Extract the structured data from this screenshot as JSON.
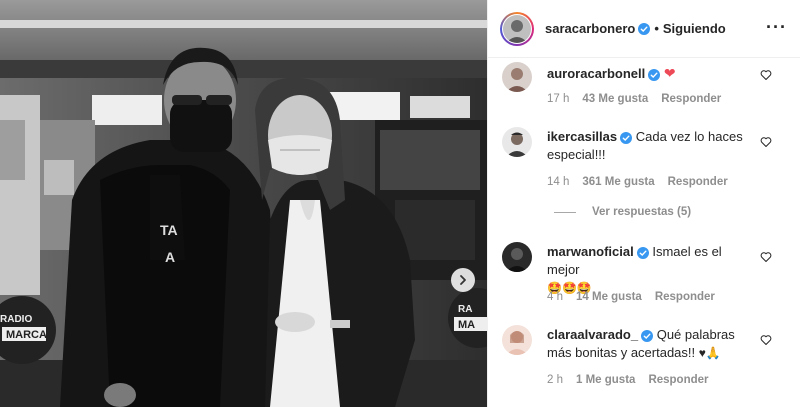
{
  "post": {
    "image_alt": "Foto en blanco y negro de dos personas con mascarilla en un estudio de radio",
    "radio_logo_left": "RADIO\nMARCA",
    "radio_logo_right": "RA\nMA"
  },
  "header": {
    "username": "saracarbonero",
    "separator": "•",
    "follow_label": "Siguiendo",
    "more_label": "···"
  },
  "comments": [
    {
      "username": "auroracarbonell",
      "verified": true,
      "text": "",
      "emoji": "❤",
      "time": "17 h",
      "likes": "43 Me gusta",
      "reply_label": "Responder"
    },
    {
      "username": "ikercasillas",
      "verified": true,
      "text": "Cada vez lo haces especial!!!",
      "time": "14 h",
      "likes": "361 Me gusta",
      "reply_label": "Responder"
    },
    {
      "username": "marwanoficial",
      "verified": true,
      "text": "Ismael es el mejor",
      "emoji": "🤩🤩🤩",
      "time": "4 h",
      "likes": "14 Me gusta",
      "reply_label": "Responder"
    },
    {
      "username": "claraalvarado_",
      "verified": true,
      "text": "Qué palabras más bonitas y acertadas!!",
      "emoji": "♥🙏",
      "time": "2 h",
      "likes": "1 Me gusta",
      "reply_label": "Responder"
    }
  ],
  "view_replies": "Ver respuestas (5)",
  "colors": {
    "verified": "#3897f0",
    "heart_red": "#ed4956",
    "meta_gray": "#8e8e8e",
    "text": "#262626"
  }
}
